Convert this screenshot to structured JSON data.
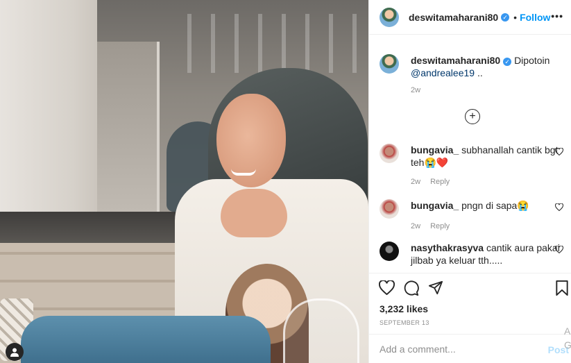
{
  "post": {
    "username": "deswitamaharani80",
    "follow_label": "Follow",
    "dot": "•",
    "more_label": "•••",
    "caption_text": "Dipotoin",
    "caption_mention": "@andrealee19",
    "caption_suffix": " ..",
    "caption_time": "2w",
    "load_more_symbol": "+",
    "likes": "3,232 likes",
    "date": "SEPTEMBER 13",
    "add_comment_placeholder": "Add a comment...",
    "post_label": "Post",
    "edge_text": "A G"
  },
  "comments": [
    {
      "username": "bungavia_",
      "text": "subhanallah cantik bgt teh😭❤️",
      "time": "2w",
      "reply": "Reply"
    },
    {
      "username": "bungavia_",
      "text": "pngn di sapa😭",
      "time": "2w",
      "reply": "Reply"
    },
    {
      "username": "nasythakrasyva",
      "text": "cantik aura pakai jilbab ya keluar tth....."
    }
  ],
  "icons": [
    "verified-icon",
    "more-icon",
    "add-circle-icon",
    "heart-icon",
    "comment-icon",
    "share-icon",
    "bookmark-icon",
    "user-icon"
  ],
  "colors": {
    "accent": "#0095f6",
    "verified": "#3897f0",
    "muted": "#8e8e8e",
    "post_disabled": "#b2dffc"
  }
}
